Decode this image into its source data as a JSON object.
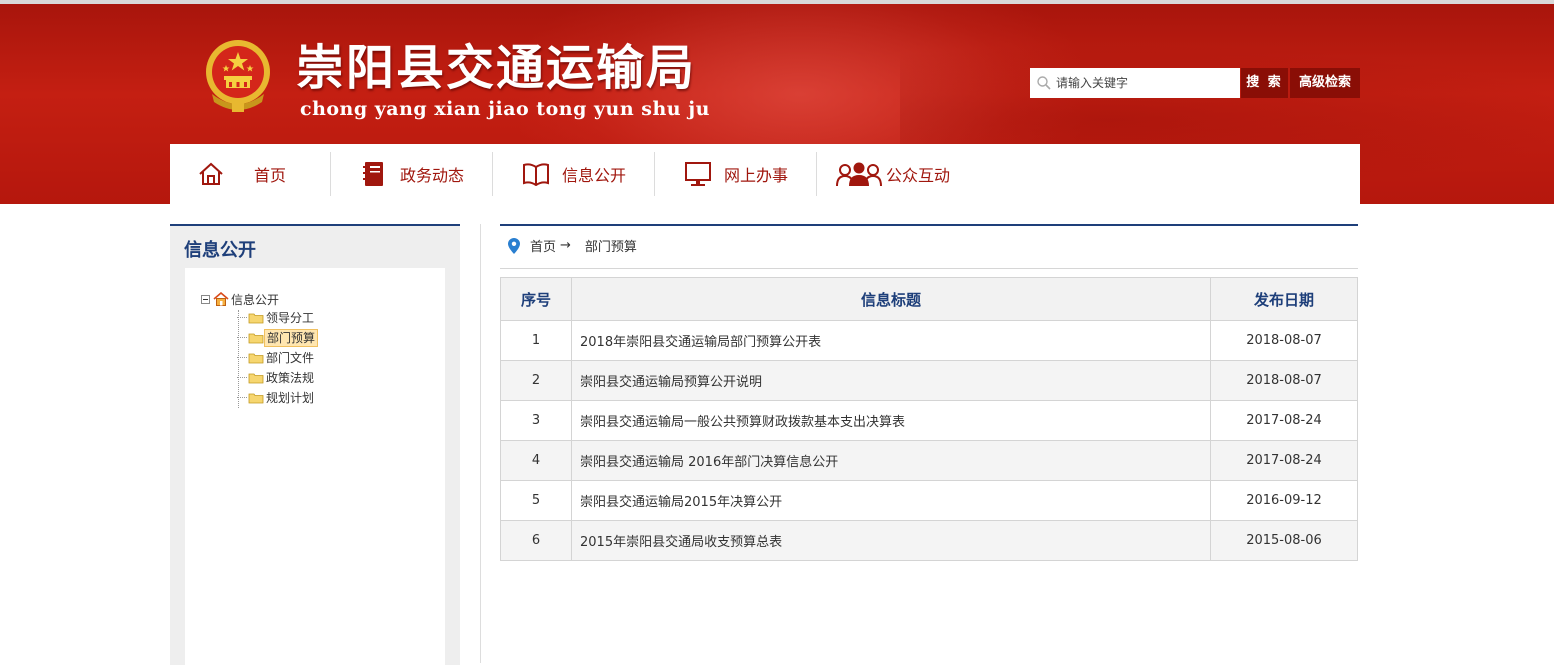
{
  "header": {
    "site_title": "崇阳县交通运输局",
    "site_pinyin": "chong yang xian jiao tong yun shu ju",
    "search": {
      "placeholder": "请输入关键字",
      "button_label": "搜 索",
      "advanced_label": "高级检索"
    }
  },
  "nav": {
    "items": [
      {
        "label": "首页",
        "icon": "home-icon"
      },
      {
        "label": "政务动态",
        "icon": "notebook-icon"
      },
      {
        "label": "信息公开",
        "icon": "open-book-icon"
      },
      {
        "label": "网上办事",
        "icon": "monitor-icon"
      },
      {
        "label": "公众互动",
        "icon": "people-icon"
      }
    ]
  },
  "sidebar": {
    "title": "信息公开",
    "tree": {
      "root": "信息公开",
      "children": [
        "领导分工",
        "部门预算",
        "部门文件",
        "政策法规",
        "规划计划"
      ],
      "selected": "部门预算"
    }
  },
  "breadcrumb": {
    "home": "首页",
    "arrow": "→",
    "current": "部门预算"
  },
  "table": {
    "headers": [
      "序号",
      "信息标题",
      "发布日期"
    ],
    "rows": [
      {
        "no": "1",
        "title": "2018年崇阳县交通运输局部门预算公开表",
        "date": "2018-08-07"
      },
      {
        "no": "2",
        "title": "崇阳县交通运输局预算公开说明",
        "date": "2018-08-07"
      },
      {
        "no": "3",
        "title": "崇阳县交通运输局一般公共预算财政拨款基本支出决算表",
        "date": "2017-08-24"
      },
      {
        "no": "4",
        "title": "崇阳县交通运输局 2016年部门决算信息公开",
        "date": "2017-08-24"
      },
      {
        "no": "5",
        "title": "崇阳县交通运输局2015年决算公开",
        "date": "2016-09-12"
      },
      {
        "no": "6",
        "title": "2015年崇阳县交通局收支预算总表",
        "date": "2015-08-06"
      }
    ]
  },
  "colors": {
    "brand_red": "#b5170d",
    "dark_red_button": "#8a0e06",
    "nav_text": "#a0170e",
    "heading_blue": "#1e3f7a"
  }
}
